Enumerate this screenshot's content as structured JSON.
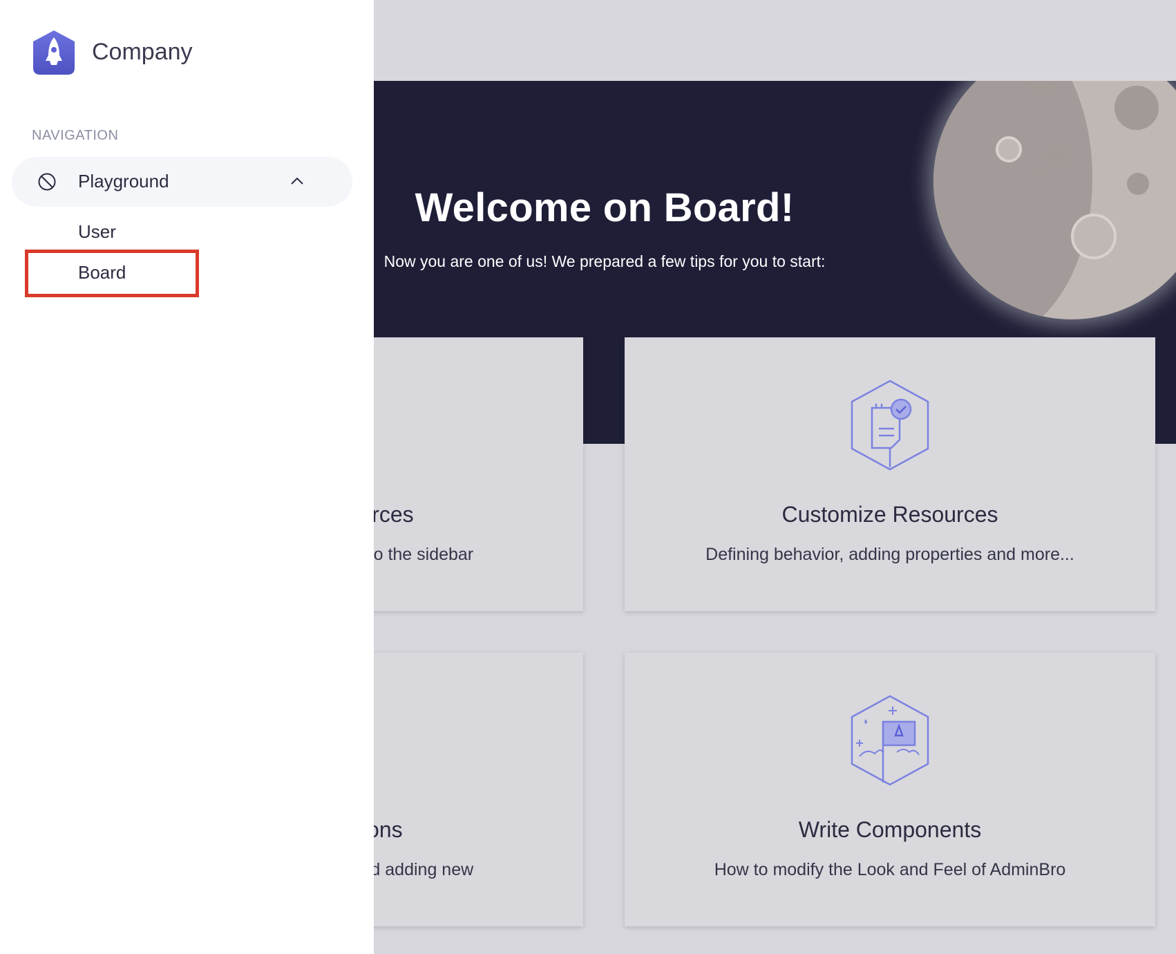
{
  "sidebar": {
    "company_name": "Company",
    "logo_icon": "rocket-logo-icon",
    "navigation_label": "NAVIGATION",
    "group": {
      "label": "Playground",
      "icon": "no-entry-icon",
      "expanded": true
    },
    "items": [
      {
        "label": "User"
      },
      {
        "label": "Board",
        "highlighted": true
      }
    ],
    "highlight_color": "#d93a2b"
  },
  "hero": {
    "title": "Welcome on Board!",
    "subtitle": "Now you are one of us! We prepared a few tips for you to start:",
    "background": "#1e1e37"
  },
  "cards": [
    {
      "title": "Map your Resources",
      "description": "Make your resources visible to the sidebar",
      "icon": "map-icon"
    },
    {
      "title": "Customize Resources",
      "description": "Defining behavior, adding properties and more...",
      "icon": "clipboard-check-icon"
    },
    {
      "title": "Customize Actions",
      "description": "Modifying existing actions and adding new",
      "icon": "actions-icon"
    },
    {
      "title": "Write Components",
      "description": "How to modify the Look and Feel of AdminBro",
      "icon": "rocket-flag-icon"
    }
  ],
  "colors": {
    "accent": "#5c61d6",
    "icon_stroke": "#7b82e0"
  }
}
